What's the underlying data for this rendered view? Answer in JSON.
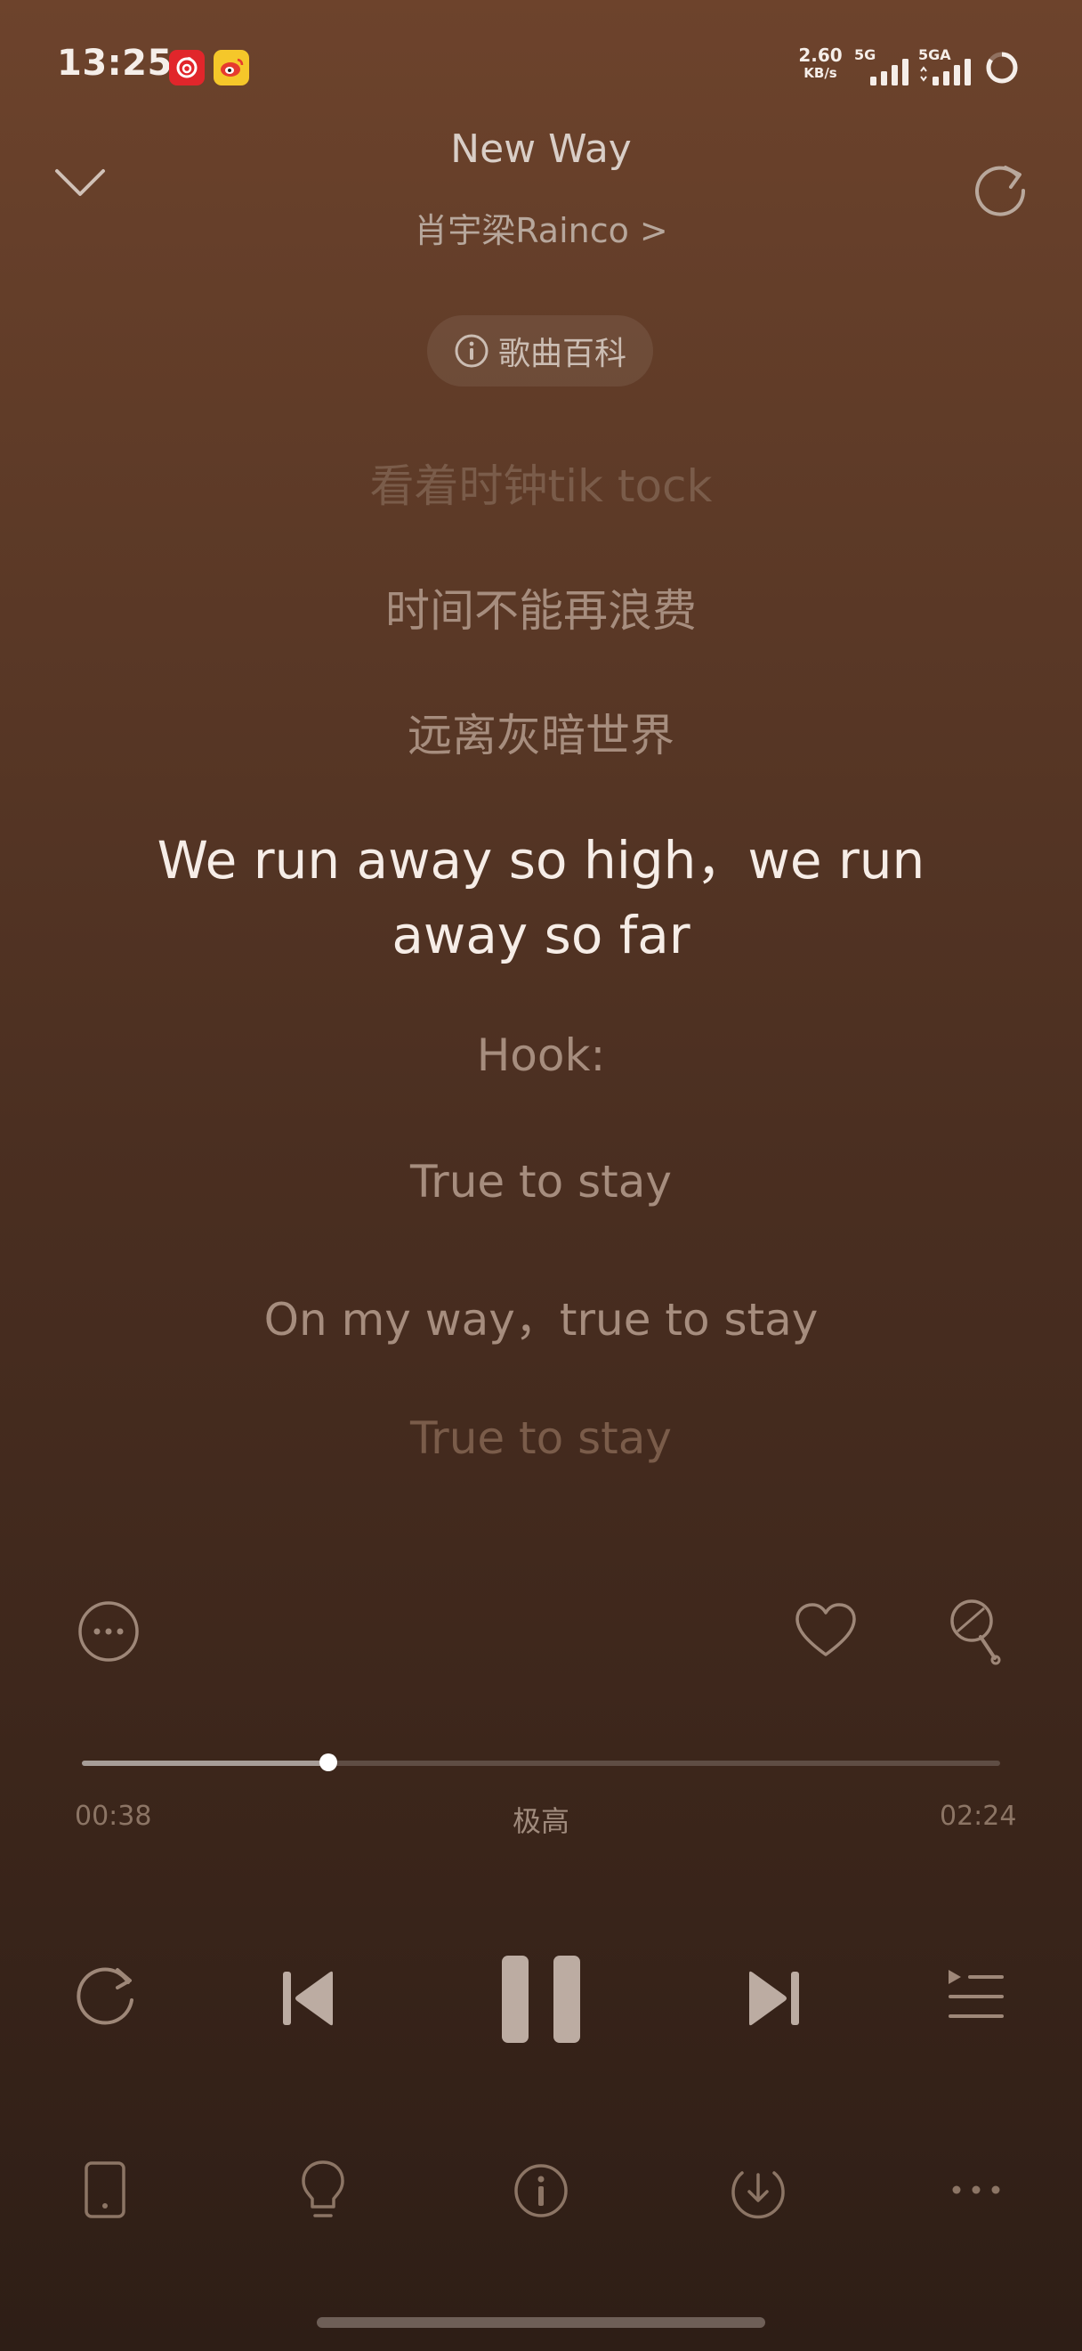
{
  "status": {
    "time": "13:25",
    "net_speed_value": "2.60",
    "net_speed_unit": "KB/s",
    "signal1_label": "5G",
    "signal2_label": "5GA"
  },
  "header": {
    "title": "New Way",
    "artist": "肖宇梁Rainco >",
    "wiki_label": "歌曲百科"
  },
  "lyrics": {
    "line1": "看着时钟tik tock",
    "line2": "时间不能再浪费",
    "line3": "远离灰暗世界",
    "active": "We run away so high，we run away so far",
    "line5": "Hook:",
    "line6": "True to stay",
    "line7": "On my way，true to stay",
    "line8": "True to stay"
  },
  "progress": {
    "current": "00:38",
    "total": "02:24",
    "quality": "极高",
    "fraction": 0.268
  },
  "icons": {
    "collapse": "chevron-down-icon",
    "share": "share-refresh-icon",
    "more": "more-circle-icon",
    "like": "heart-icon",
    "sing": "microphone-icon",
    "repeat": "repeat-icon",
    "prev": "previous-icon",
    "pause": "pause-icon",
    "next": "next-icon",
    "playlist": "playlist-icon",
    "device": "phone-icon",
    "tips": "lightbulb-icon",
    "info": "info-icon",
    "download": "download-icon",
    "overflow": "ellipsis-icon"
  },
  "colors": {
    "netease_badge": "#e1262b",
    "weibo_badge": "#f5c72a"
  }
}
